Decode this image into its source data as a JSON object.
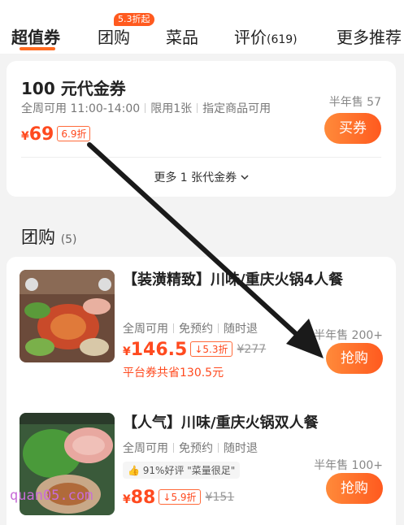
{
  "tabs": {
    "items": [
      {
        "label": "超值券",
        "count": ""
      },
      {
        "label": "团购",
        "count": ""
      },
      {
        "label": "菜品",
        "count": ""
      },
      {
        "label": "评价",
        "count": "(619)"
      },
      {
        "label": "更多推荐",
        "count": ""
      }
    ],
    "active": "超值券",
    "group_badge": "5.3折起"
  },
  "coupon": {
    "title": "100 元代金券",
    "meta": [
      "全周可用 11:00-14:00",
      "限用1张",
      "指定商品可用"
    ],
    "currency": "¥",
    "price": "69",
    "discount": "6.9折",
    "sold": "半年售 57",
    "button": "买券",
    "more": "更多 1 张代金券"
  },
  "group_section": {
    "title": "团购",
    "count": "(5)"
  },
  "deals": [
    {
      "title": "【装潢精致】川味/重庆火锅4人餐",
      "tags": [
        "全周可用",
        "免预约",
        "随时退"
      ],
      "currency": "¥",
      "price": "146.5",
      "discount": "5.3折",
      "original": "¥277",
      "savings": "平台券共省130.5元",
      "sold": "半年售 200+",
      "button": "抢购"
    },
    {
      "title": "【人气】川味/重庆火锅双人餐",
      "tags": [
        "全周可用",
        "免预约",
        "随时退"
      ],
      "review": "91%好评 \"菜量很足\"",
      "currency": "¥",
      "price": "88",
      "discount": "5.9折",
      "original": "¥151",
      "sold": "半年售 100+",
      "button": "抢购"
    }
  ],
  "watermark": "quan05.com",
  "colors": {
    "accent": "#ff5a1f",
    "price": "#ff4a1f",
    "background": "#f3f3f3"
  }
}
